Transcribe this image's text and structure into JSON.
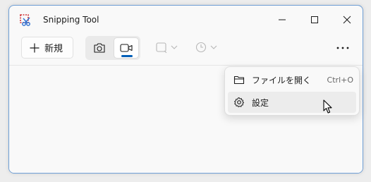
{
  "window": {
    "title": "Snipping Tool"
  },
  "toolbar": {
    "new_label": "新規",
    "snip_mode": "video",
    "icons": {
      "new": "plus-icon",
      "photo": "camera-icon",
      "video": "video-camera-icon",
      "shape": "rectangle-snip-icon",
      "timer": "clock-icon",
      "more": "more-horizontal-icon"
    }
  },
  "menu": {
    "items": [
      {
        "icon": "folder-icon",
        "label": "ファイルを開く",
        "shortcut": "Ctrl+O"
      },
      {
        "icon": "settings-gear-icon",
        "label": "設定",
        "shortcut": ""
      }
    ]
  },
  "colors": {
    "accent": "#005fb8",
    "window_border": "#6f9fd6",
    "app_icon_red": "#d13438"
  }
}
